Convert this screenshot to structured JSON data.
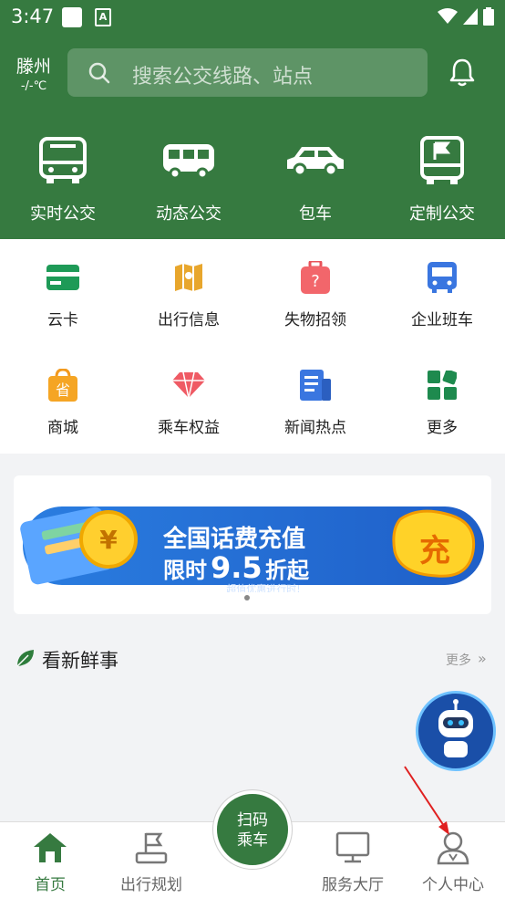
{
  "status": {
    "time": "3:47"
  },
  "header": {
    "city": "滕州",
    "temp": "-/-℃",
    "search_placeholder": "搜索公交线路、站点"
  },
  "top_features": [
    {
      "label": "实时公交",
      "icon": "bus-icon"
    },
    {
      "label": "动态公交",
      "icon": "minibus-icon"
    },
    {
      "label": "包车",
      "icon": "car-icon"
    },
    {
      "label": "定制公交",
      "icon": "custom-bus-icon"
    }
  ],
  "grid": [
    {
      "label": "云卡",
      "icon": "card-icon"
    },
    {
      "label": "出行信息",
      "icon": "map-icon"
    },
    {
      "label": "失物招领",
      "icon": "luggage-icon"
    },
    {
      "label": "企业班车",
      "icon": "shuttle-icon"
    },
    {
      "label": "商城",
      "icon": "shop-bag-icon"
    },
    {
      "label": "乘车权益",
      "icon": "diamond-icon"
    },
    {
      "label": "新闻热点",
      "icon": "news-icon"
    },
    {
      "label": "更多",
      "icon": "more-grid-icon"
    }
  ],
  "banner": {
    "line1": "全国话费充值",
    "line2a": "限时",
    "line2b": "9.5",
    "line2c": "折起",
    "sub": "超值优惠进行时!",
    "badge": "充",
    "coin": "¥"
  },
  "news": {
    "title": "看新鲜事",
    "more": "更多"
  },
  "scan": {
    "line1": "扫码",
    "line2": "乘车"
  },
  "bottom_nav": [
    {
      "label": "首页",
      "icon": "home-icon"
    },
    {
      "label": "出行规划",
      "icon": "route-flag-icon"
    },
    {
      "label": "服务大厅",
      "icon": "monitor-icon"
    },
    {
      "label": "个人中心",
      "icon": "user-icon"
    }
  ],
  "colors": {
    "primary": "#367a40",
    "annotation_arrow": "#e02020"
  }
}
